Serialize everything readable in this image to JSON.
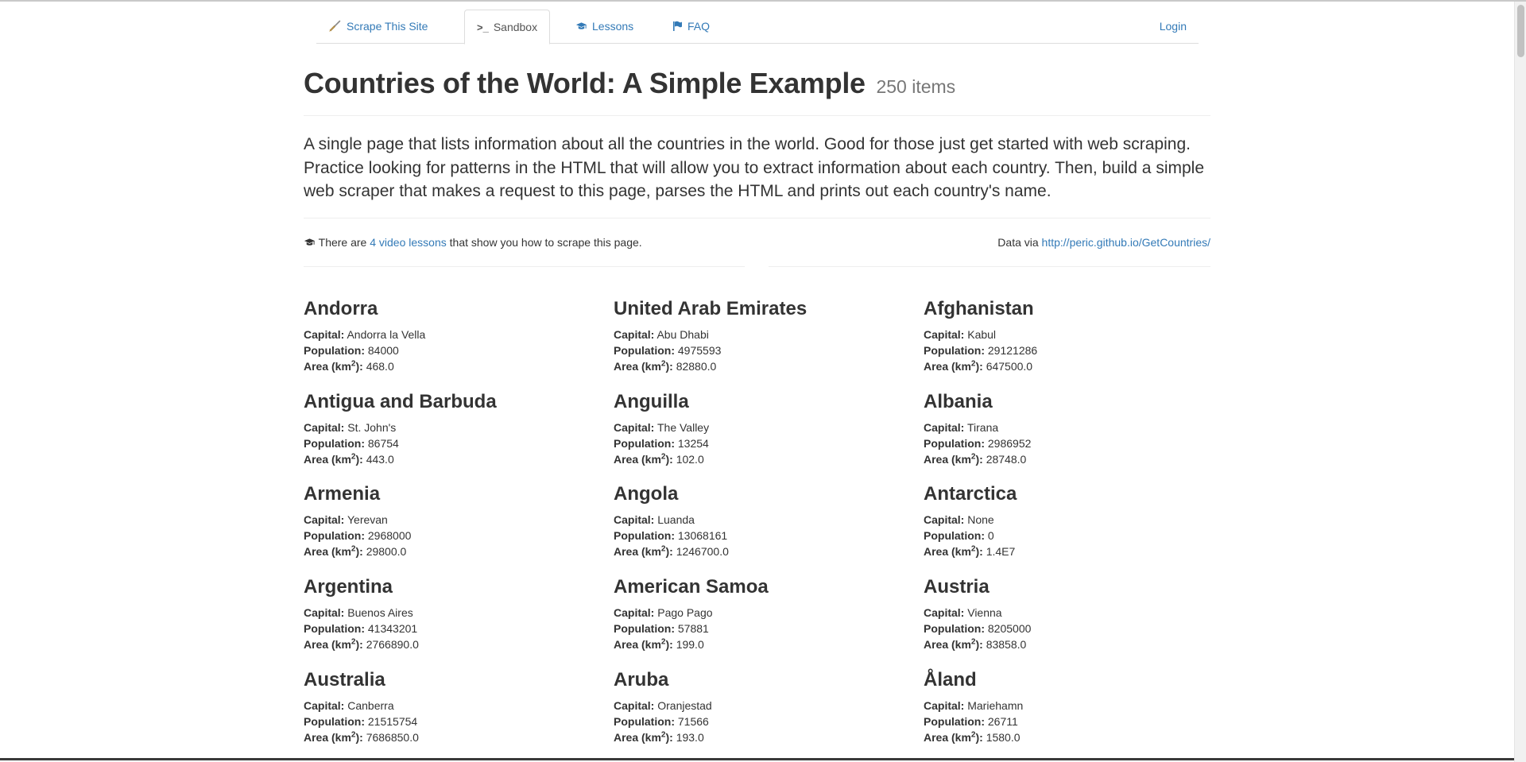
{
  "nav": {
    "items": [
      {
        "label": "Scrape This Site",
        "icon": "broom-icon"
      },
      {
        "label": "Sandbox",
        "icon": "terminal-icon"
      },
      {
        "label": "Lessons",
        "icon": "graduation-cap-icon"
      },
      {
        "label": "FAQ",
        "icon": "flag-icon"
      }
    ],
    "login": "Login"
  },
  "header": {
    "title": "Countries of the World: A Simple Example",
    "count": "250 items"
  },
  "lead": "A single page that lists information about all the countries in the world. Good for those just get started with web scraping. Practice looking for patterns in the HTML that will allow you to extract information about each country. Then, build a simple web scraper that makes a request to this page, parses the HTML and prints out each country's name.",
  "meta": {
    "prefix": "There are",
    "lessons_link": "4 video lessons",
    "suffix": "that show you how to scrape this page.",
    "data_via": "Data via",
    "data_link": "http://peric.github.io/GetCountries/"
  },
  "labels": {
    "capital": "Capital:",
    "population": "Population:",
    "area": "Area (km",
    "area_sup": "2",
    "area_end": "):"
  },
  "countries": [
    {
      "name": "Andorra",
      "capital": "Andorra la Vella",
      "population": "84000",
      "area": "468.0"
    },
    {
      "name": "United Arab Emirates",
      "capital": "Abu Dhabi",
      "population": "4975593",
      "area": "82880.0"
    },
    {
      "name": "Afghanistan",
      "capital": "Kabul",
      "population": "29121286",
      "area": "647500.0"
    },
    {
      "name": "Antigua and Barbuda",
      "capital": "St. John's",
      "population": "86754",
      "area": "443.0"
    },
    {
      "name": "Anguilla",
      "capital": "The Valley",
      "population": "13254",
      "area": "102.0"
    },
    {
      "name": "Albania",
      "capital": "Tirana",
      "population": "2986952",
      "area": "28748.0"
    },
    {
      "name": "Armenia",
      "capital": "Yerevan",
      "population": "2968000",
      "area": "29800.0"
    },
    {
      "name": "Angola",
      "capital": "Luanda",
      "population": "13068161",
      "area": "1246700.0"
    },
    {
      "name": "Antarctica",
      "capital": "None",
      "population": "0",
      "area": "1.4E7"
    },
    {
      "name": "Argentina",
      "capital": "Buenos Aires",
      "population": "41343201",
      "area": "2766890.0"
    },
    {
      "name": "American Samoa",
      "capital": "Pago Pago",
      "population": "57881",
      "area": "199.0"
    },
    {
      "name": "Austria",
      "capital": "Vienna",
      "population": "8205000",
      "area": "83858.0"
    },
    {
      "name": "Australia",
      "capital": "Canberra",
      "population": "21515754",
      "area": "7686850.0"
    },
    {
      "name": "Aruba",
      "capital": "Oranjestad",
      "population": "71566",
      "area": "193.0"
    },
    {
      "name": "Åland",
      "capital": "Mariehamn",
      "population": "26711",
      "area": "1580.0"
    }
  ],
  "colors": {
    "link": "#337ab7",
    "text": "#333333",
    "muted": "#777777"
  }
}
